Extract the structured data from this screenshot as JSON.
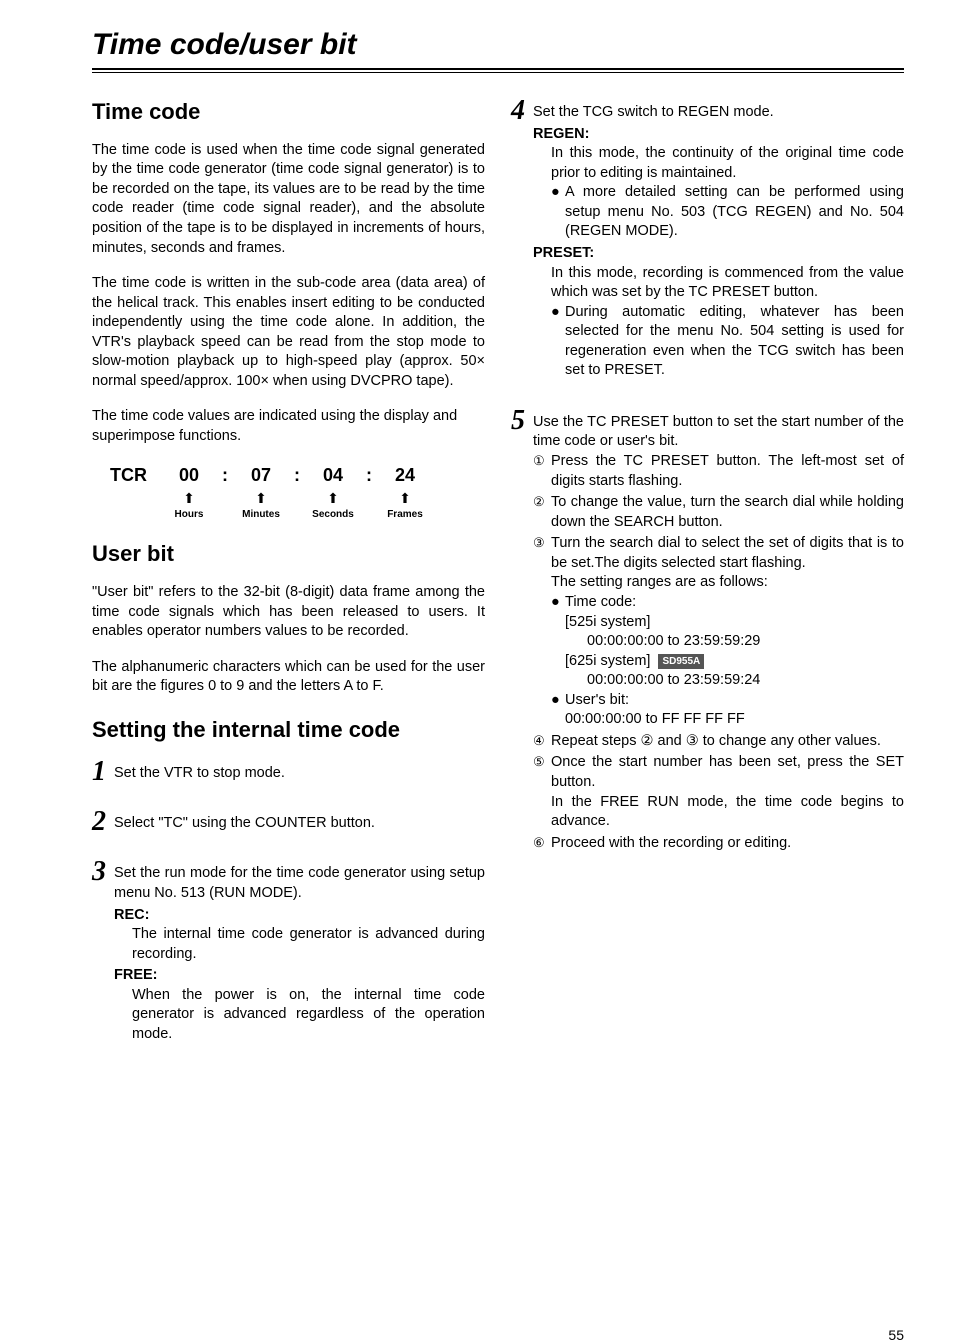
{
  "page_title": "Time code/user bit",
  "page_number": "55",
  "left": {
    "h_timecode": "Time code",
    "p1": "The time code is used when the time code signal generated by the time code generator (time code signal generator) is to be recorded on the tape, its values are to be read by the time code reader (time code signal reader), and the absolute position of the tape is to be displayed in increments of hours, minutes, seconds and frames.",
    "p2": "The time code is written in the sub-code area (data area) of the helical track. This enables insert editing to be conducted independently using the time code alone. In addition, the VTR's playback speed can be read from the stop mode to slow-motion playback up to high-speed play (approx. 50× normal speed/approx. 100× when using DVCPRO tape).",
    "p3": "The time code values are indicated using the display and superimpose functions.",
    "tcr": {
      "label": "TCR",
      "hours": "00",
      "minutes": "07",
      "seconds": "04",
      "frames": "24",
      "lab_hours": "Hours",
      "lab_minutes": "Minutes",
      "lab_seconds": "Seconds",
      "lab_frames": "Frames"
    },
    "h_userbit": "User bit",
    "ub_p1": "\"User bit\" refers to the 32-bit (8-digit) data frame among the time code signals which has been released to users. It enables operator numbers values to be recorded.",
    "ub_p2": "The alphanumeric characters which can be used for the user bit are the figures 0 to 9 and the letters A to F.",
    "h_setting": "Setting the internal time code",
    "step1": "Set the VTR to stop mode.",
    "step2": "Select \"TC\" using the COUNTER button.",
    "step3_lead": "Set the run mode for the time code generator using setup menu No. 513 (RUN MODE).",
    "step3_rec_label": "REC:",
    "step3_rec_text": "The internal time code generator is advanced during recording.",
    "step3_free_label": "FREE:",
    "step3_free_text": "When the power is on, the internal time code generator is advanced regardless of the operation mode."
  },
  "right": {
    "step4_lead": "Set the TCG switch to REGEN mode.",
    "step4_regen_label": "REGEN:",
    "step4_regen_text": "In this mode, the continuity of the original time code prior to editing is maintained.",
    "step4_regen_bullet": "A more detailed setting can be performed using setup menu No. 503 (TCG REGEN) and No. 504 (REGEN MODE).",
    "step4_preset_label": "PRESET:",
    "step4_preset_text": "In this mode, recording is commenced from the value which was set by the TC PRESET button.",
    "step4_preset_bullet": "During automatic editing, whatever has been selected for the menu No. 504 setting is used for regeneration even when the TCG switch has been set to PRESET.",
    "step5_lead": "Use the TC PRESET button to set the start number of the time code or user's bit.",
    "step5_1": "Press the TC PRESET button. The left-most set of digits starts flashing.",
    "step5_2": "To change the value, turn the search dial while holding down the SEARCH button.",
    "step5_3": "Turn the search dial to select the set of digits that is to be set.The digits selected start flashing.",
    "step5_3b": "The setting ranges are as follows:",
    "step5_tc_label": "Time code:",
    "step5_tc_525_label": "[525i system]",
    "step5_tc_525_range": "00:00:00:00 to 23:59:59:29",
    "step5_tc_625_label": "[625i system]",
    "step5_tc_625_range": "00:00:00:00 to 23:59:59:24",
    "step5_badge": "SD955A",
    "step5_ub_label": "User's bit:",
    "step5_ub_range": "00:00:00:00 to FF FF FF FF",
    "step5_4": "Repeat steps ② and ③ to change any other values.",
    "step5_5a": "Once the start number has been set, press the SET button.",
    "step5_5b": "In the FREE RUN mode, the time code begins to advance.",
    "step5_6": "Proceed with the recording or editing."
  },
  "nums": {
    "n1": "1",
    "n2": "2",
    "n3": "3",
    "n4": "4",
    "n5": "5",
    "c1": "①",
    "c2": "②",
    "c3": "③",
    "c4": "④",
    "c5": "⑤",
    "c6": "⑥"
  },
  "chart_data": {
    "type": "table",
    "title": "TCR display example",
    "categories": [
      "Hours",
      "Minutes",
      "Seconds",
      "Frames"
    ],
    "values": [
      "00",
      "07",
      "04",
      "24"
    ]
  }
}
